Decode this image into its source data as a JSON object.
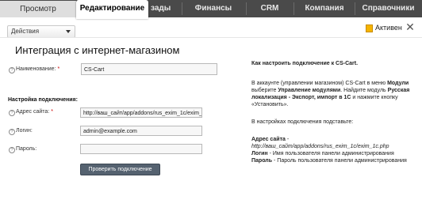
{
  "tabs": {
    "preview": "Просмотр",
    "edit": "Редактирование",
    "hidden_tab": "зады",
    "finance": "Финансы",
    "crm": "CRM",
    "company": "Компания",
    "references": "Справочники"
  },
  "toolbar": {
    "actions_label": "Действия",
    "status_text": "Активен"
  },
  "page": {
    "title": "Интеграция с интернет-магазином"
  },
  "form": {
    "name_label": "Наименование:",
    "name_value": "CS-Cart",
    "section_title": "Настройка подключения:",
    "site_label": "Адрес сайта:",
    "site_value": "http://ваш_сайт/app/addons/rus_exim_1c/exim_1",
    "login_label": "Логин:",
    "login_value": "admin@example.com",
    "password_label": "Пароль:",
    "password_value": "",
    "check_button": "Проверить подключение",
    "required_mark": "*"
  },
  "help": {
    "title": "Как настроить подключение к CS-Cart.",
    "p1_a": "В аккаунте (управлении магазином) CS-Cart в меню",
    "p1_b": "Модули",
    "p1_c": " выберите ",
    "p1_d": "Управление модулями",
    "p1_e": ". Найдите модуль ",
    "p1_f": "Русская локализация - Экспорт, импорт в 1С",
    "p1_g": " и нажмите кнопку «Установить».",
    "p2": "В настройках подключения подставьте:",
    "site_title": "Адрес сайта",
    "site_dash": " -",
    "site_path": "http://ваш_сайт/app/addons/rus_exim_1c/exim_1c.php",
    "login_title": "Логин",
    "login_desc": " - Имя пользователя панели администрирования",
    "password_title": "Пароль",
    "password_desc": " - Пароль пользователя панели администрирования"
  }
}
